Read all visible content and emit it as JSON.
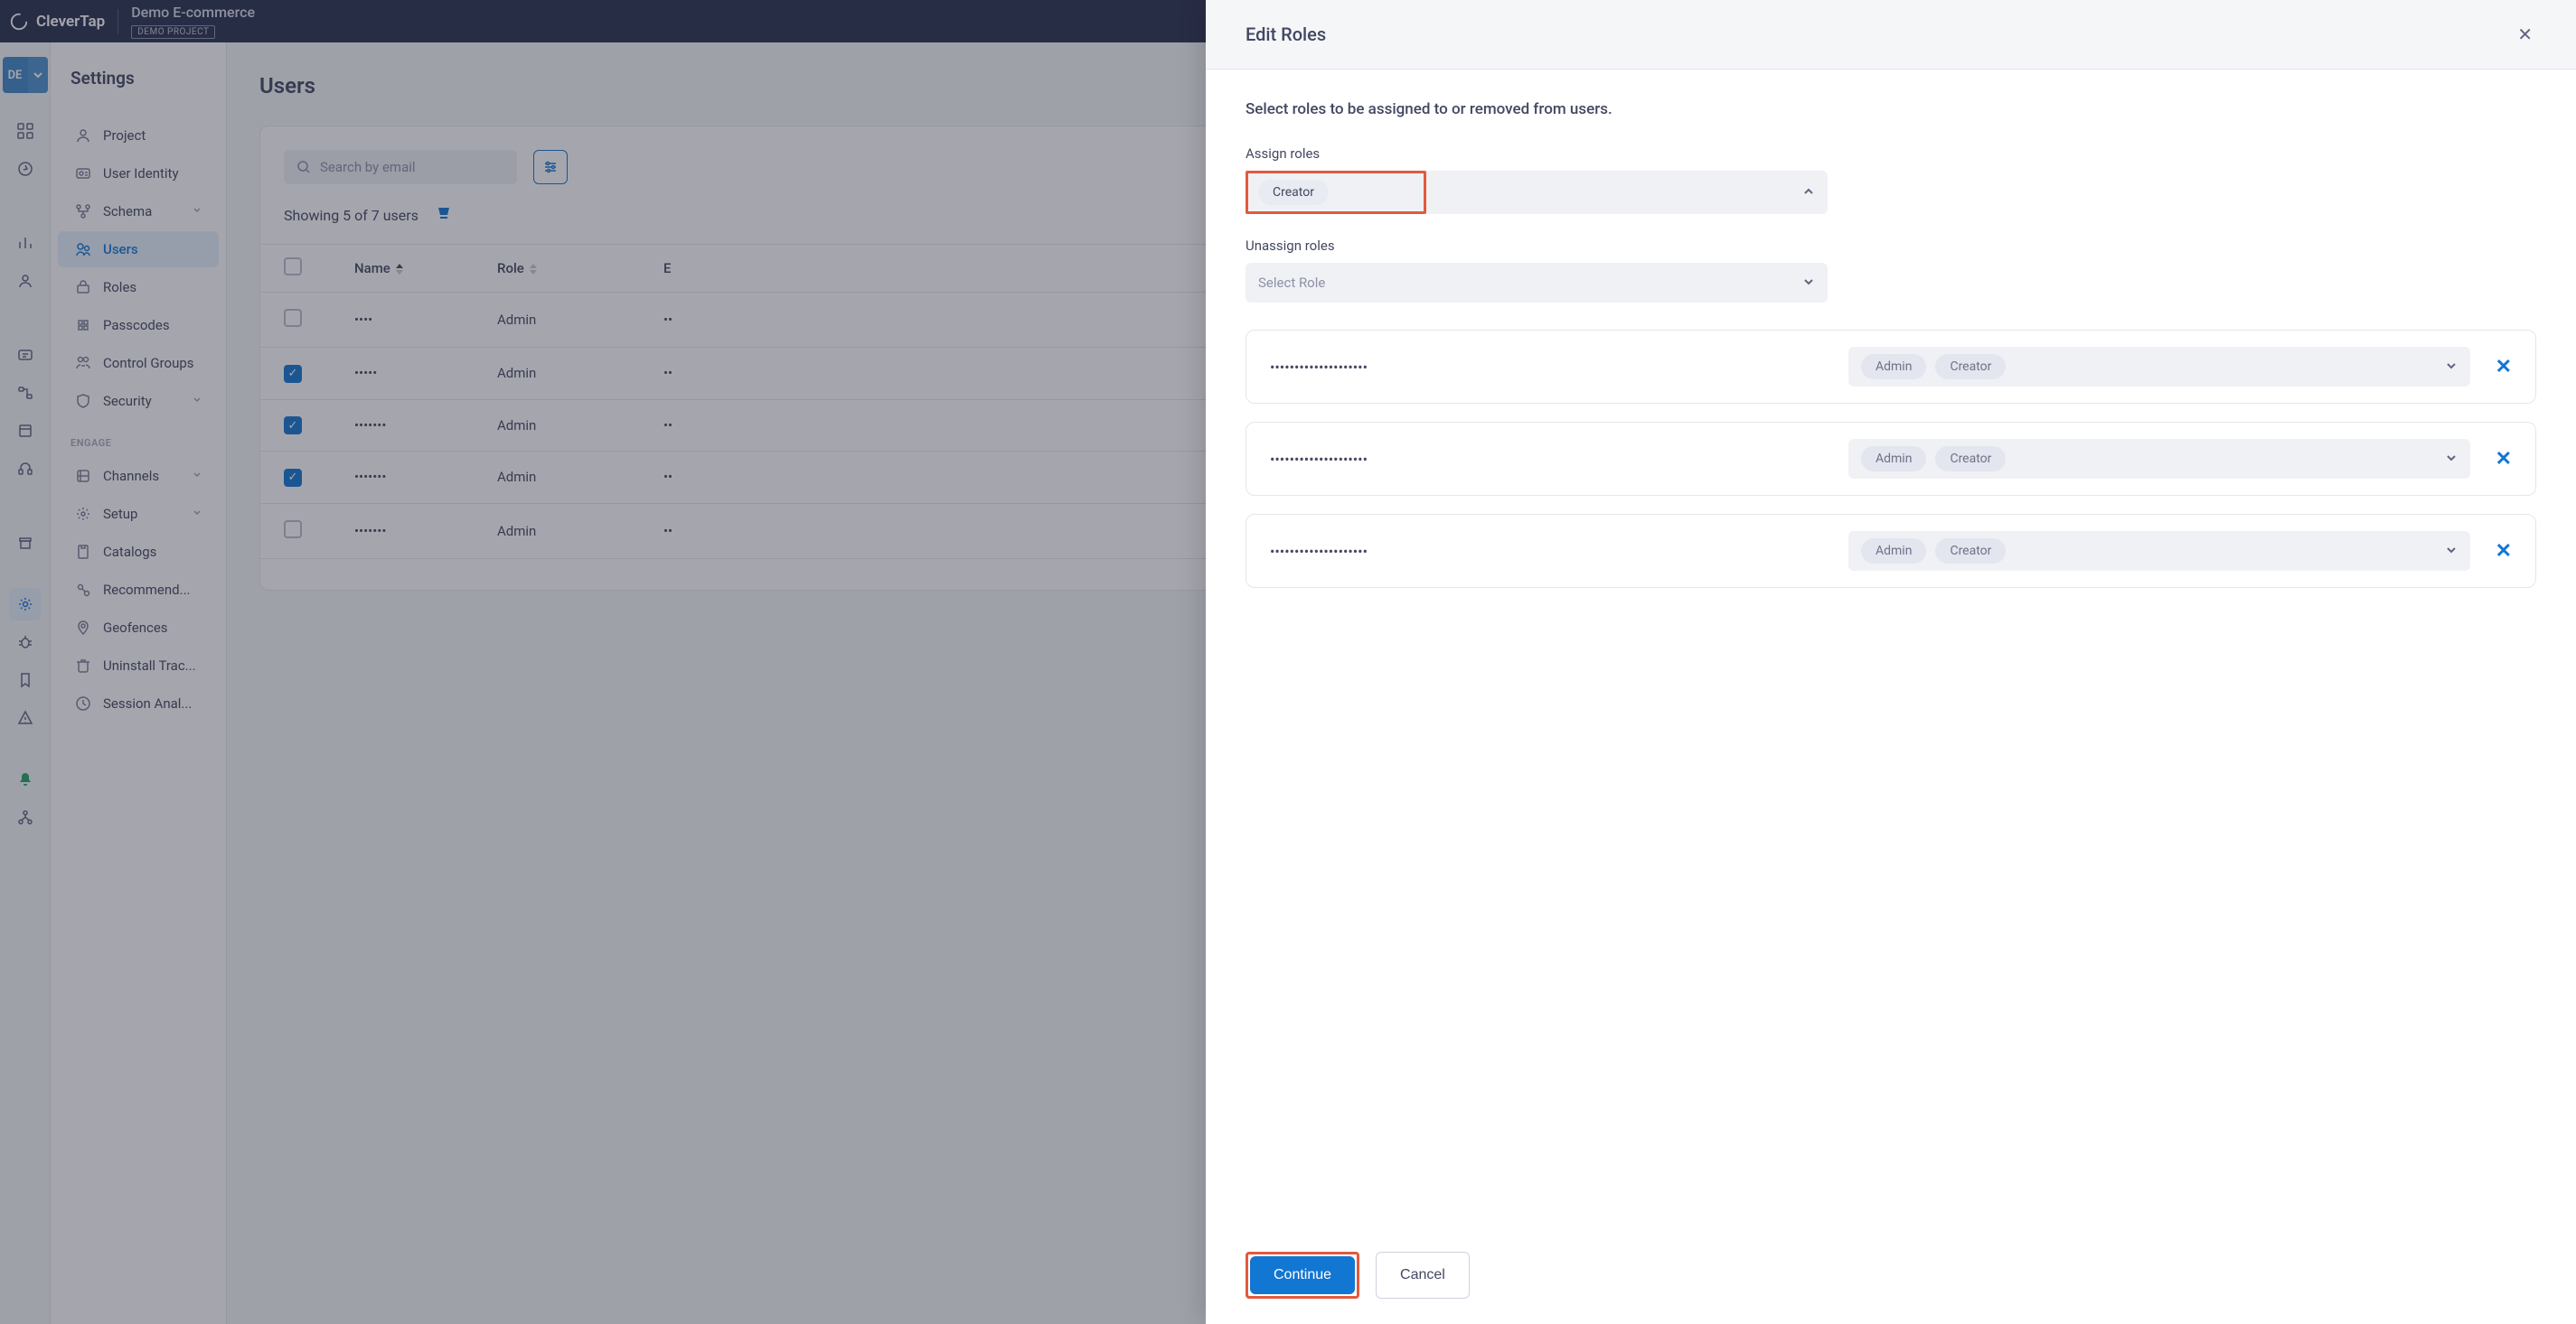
{
  "brand": "CleverTap",
  "project": {
    "name": "Demo E-commerce",
    "badge": "DEMO PROJECT",
    "short": "DE"
  },
  "sidebar": {
    "title": "Settings",
    "items": [
      {
        "label": "Project"
      },
      {
        "label": "User Identity"
      },
      {
        "label": "Schema",
        "expandable": true
      },
      {
        "label": "Users",
        "active": true
      },
      {
        "label": "Roles"
      },
      {
        "label": "Passcodes"
      },
      {
        "label": "Control Groups"
      },
      {
        "label": "Security",
        "expandable": true
      }
    ],
    "engage_heading": "ENGAGE",
    "engage_items": [
      {
        "label": "Channels",
        "expandable": true
      },
      {
        "label": "Setup",
        "expandable": true
      },
      {
        "label": "Catalogs"
      },
      {
        "label": "Recommend..."
      },
      {
        "label": "Geofences"
      },
      {
        "label": "Uninstall Trac..."
      },
      {
        "label": "Session Anal..."
      }
    ]
  },
  "main": {
    "title": "Users",
    "search_placeholder": "Search by email",
    "showing": "Showing 5 of 7 users",
    "columns": {
      "name": "Name",
      "role": "Role",
      "email": "E"
    },
    "rows": [
      {
        "checked": false,
        "name": "••••",
        "role": "Admin",
        "email": "••"
      },
      {
        "checked": true,
        "name": "•••••",
        "role": "Admin",
        "email": "••"
      },
      {
        "checked": true,
        "name": "•••••••",
        "role": "Admin",
        "email": "••"
      },
      {
        "checked": true,
        "name": "•••••••",
        "role": "Admin",
        "email": "••"
      },
      {
        "checked": false,
        "name": "•••••••",
        "role": "Admin",
        "email": "••"
      }
    ]
  },
  "drawer": {
    "title": "Edit Roles",
    "lead": "Select roles to be assigned to or removed from users.",
    "assign_label": "Assign roles",
    "assign_selected": "Creator",
    "unassign_label": "Unassign roles",
    "unassign_placeholder": "Select Role",
    "users": [
      {
        "email": "••••••••••••••••••••",
        "roles": [
          "Admin",
          "Creator"
        ]
      },
      {
        "email": "••••••••••••••••••••",
        "roles": [
          "Admin",
          "Creator"
        ]
      },
      {
        "email": "••••••••••••••••••••",
        "roles": [
          "Admin",
          "Creator"
        ]
      }
    ],
    "continue_label": "Continue",
    "cancel_label": "Cancel"
  }
}
